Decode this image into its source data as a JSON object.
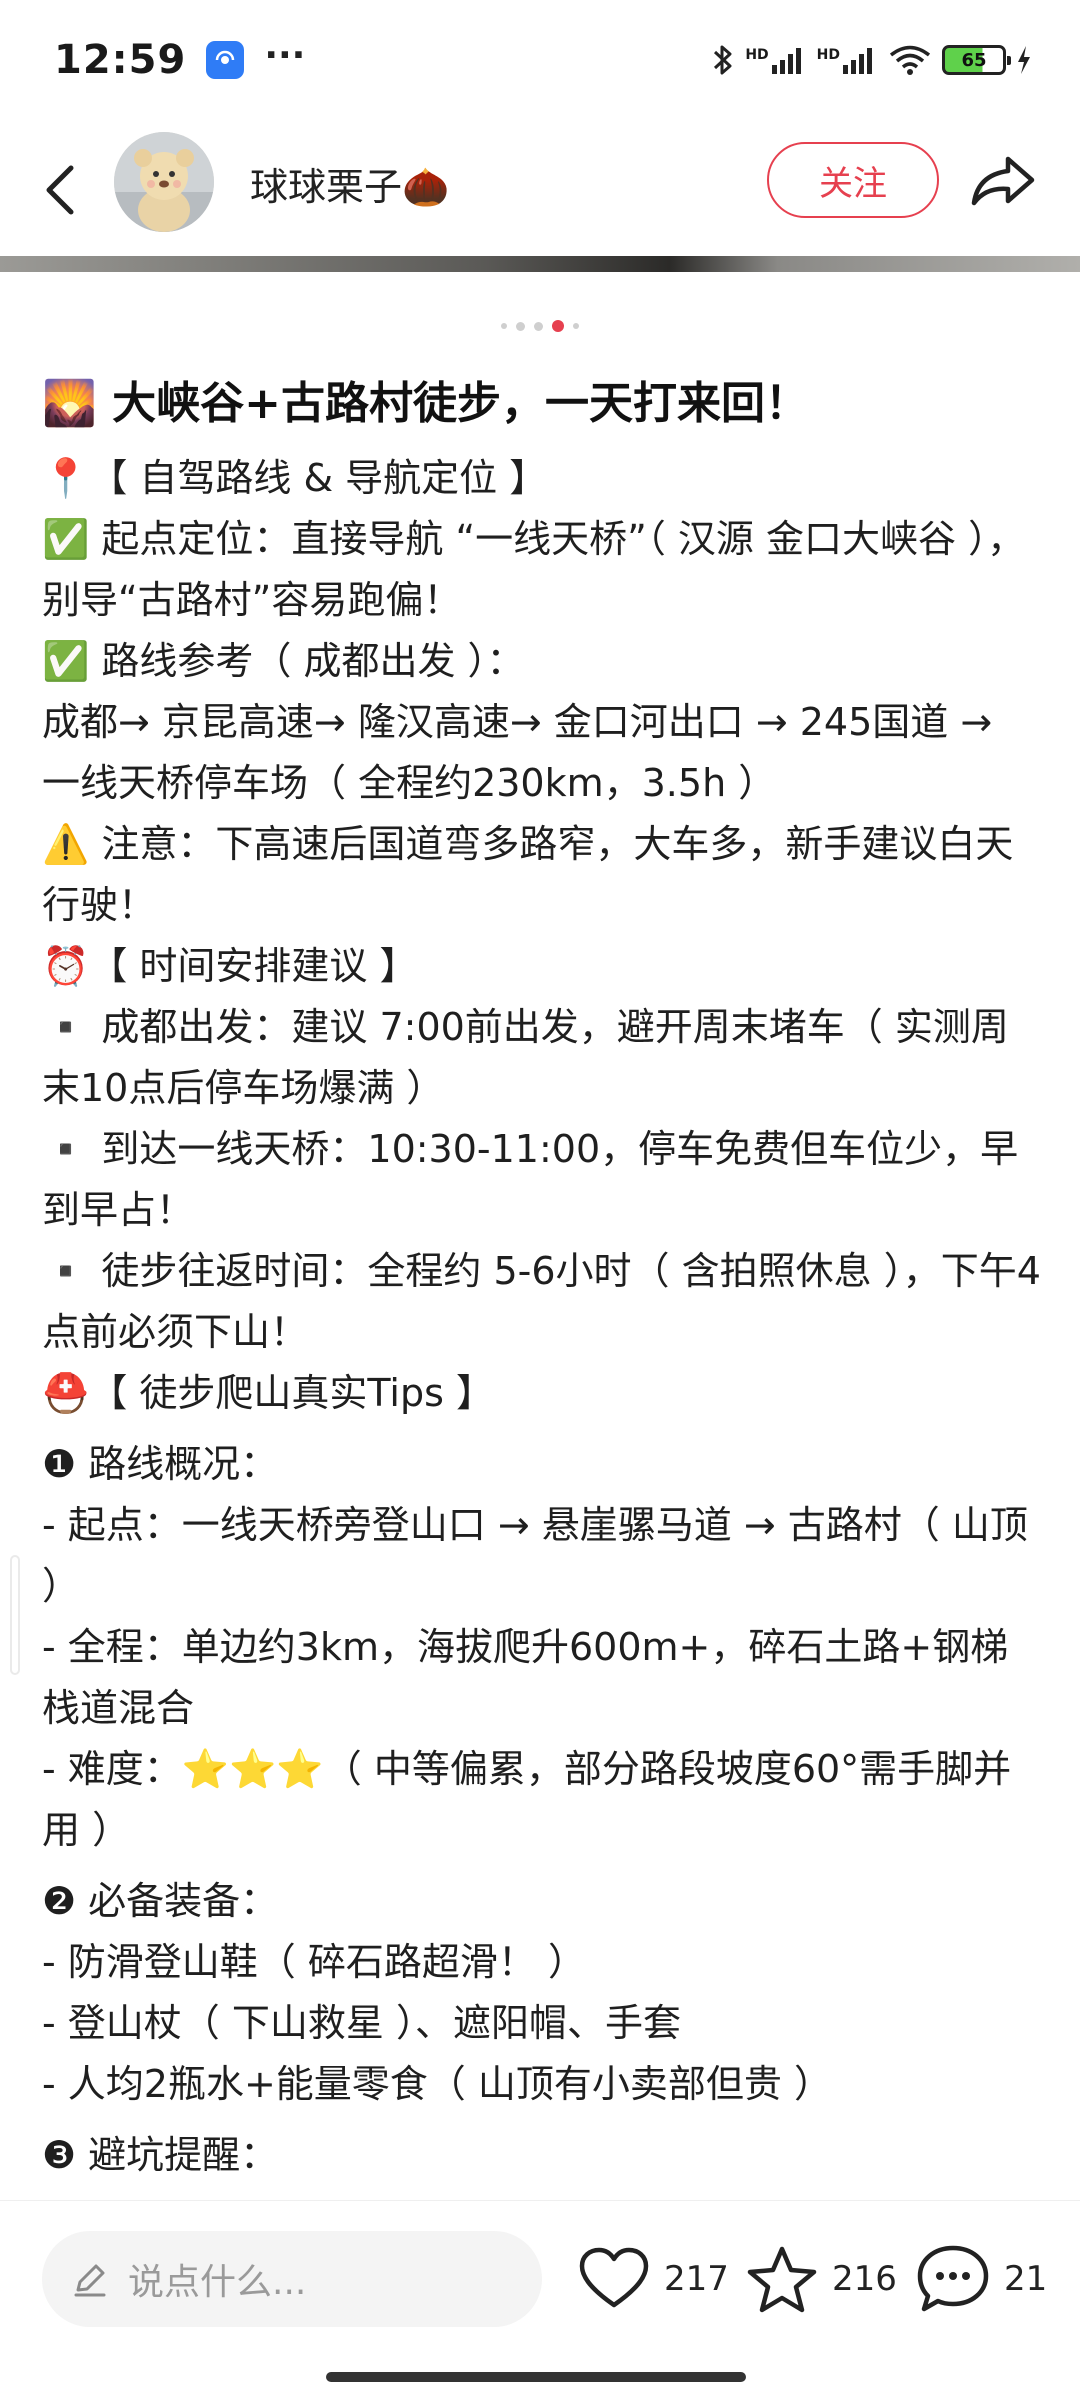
{
  "status_bar": {
    "time": "12:59",
    "more": "···",
    "hd1": "HD",
    "hd2": "HD",
    "battery": "65"
  },
  "header": {
    "author_name": "球球栗子🌰",
    "follow_label": "关注"
  },
  "pager": {
    "count": 5,
    "active_index": 3
  },
  "post": {
    "title": "🌄 大峡谷+古路村徒步，一天打来回！",
    "lines": [
      "📍【 自驾路线 & 导航定位 】",
      "✅ 起点定位：直接导航 “一线天桥”（ 汉源 金口大峡谷 ），别导“古路村”容易跑偏！",
      "✅ 路线参考（ 成都出发 ）：",
      "成都→ 京昆高速→ 隆汉高速→ 金口河出口 → 245国道 → 一线天桥停车场（ 全程约230km，3.5h ）",
      "⚠️ 注意：下高速后国道弯多路窄，大车多，新手建议白天行驶！",
      "⏰【 时间安排建议 】",
      "▪️ 成都出发：建议 7:00前出发，避开周末堵车（ 实测周末10点后停车场爆满 ）",
      "▪️ 到达一线天桥：10:30-11:00，停车免费但车位少，早到早占！",
      "▪️ 徒步往返时间：全程约 5-6小时（ 含拍照休息 ），下午4点前必须下山！",
      "⛑️【 徒步爬山真实Tips 】",
      "❶ 路线概况：",
      "- 起点：一线天桥旁登山口 → 悬崖骡马道 → 古路村（ 山顶 ）",
      "- 全程：单边约3km，海拔爬升600m+，碎石土路+钢梯栈道混合",
      "- 难度：⭐⭐⭐（ 中等偏累，部分路段坡度60°需手脚并用 ）",
      "❷ 必备装备：",
      "- 防滑登山鞋（ 碎石路超滑！ ）",
      "- 登山杖（ 下山救星 ）、遮阳帽、手套",
      "- 人均2瓶水+能量零食（ 山顶有小卖部但贵 ）",
      "❸ 避坑提醒："
    ]
  },
  "bottom_bar": {
    "comment_placeholder": "说点什么...",
    "likes": "217",
    "favorites": "216",
    "comments": "21"
  },
  "colors": {
    "accent": "#e6404f",
    "input_bg": "#f4f4f4"
  }
}
